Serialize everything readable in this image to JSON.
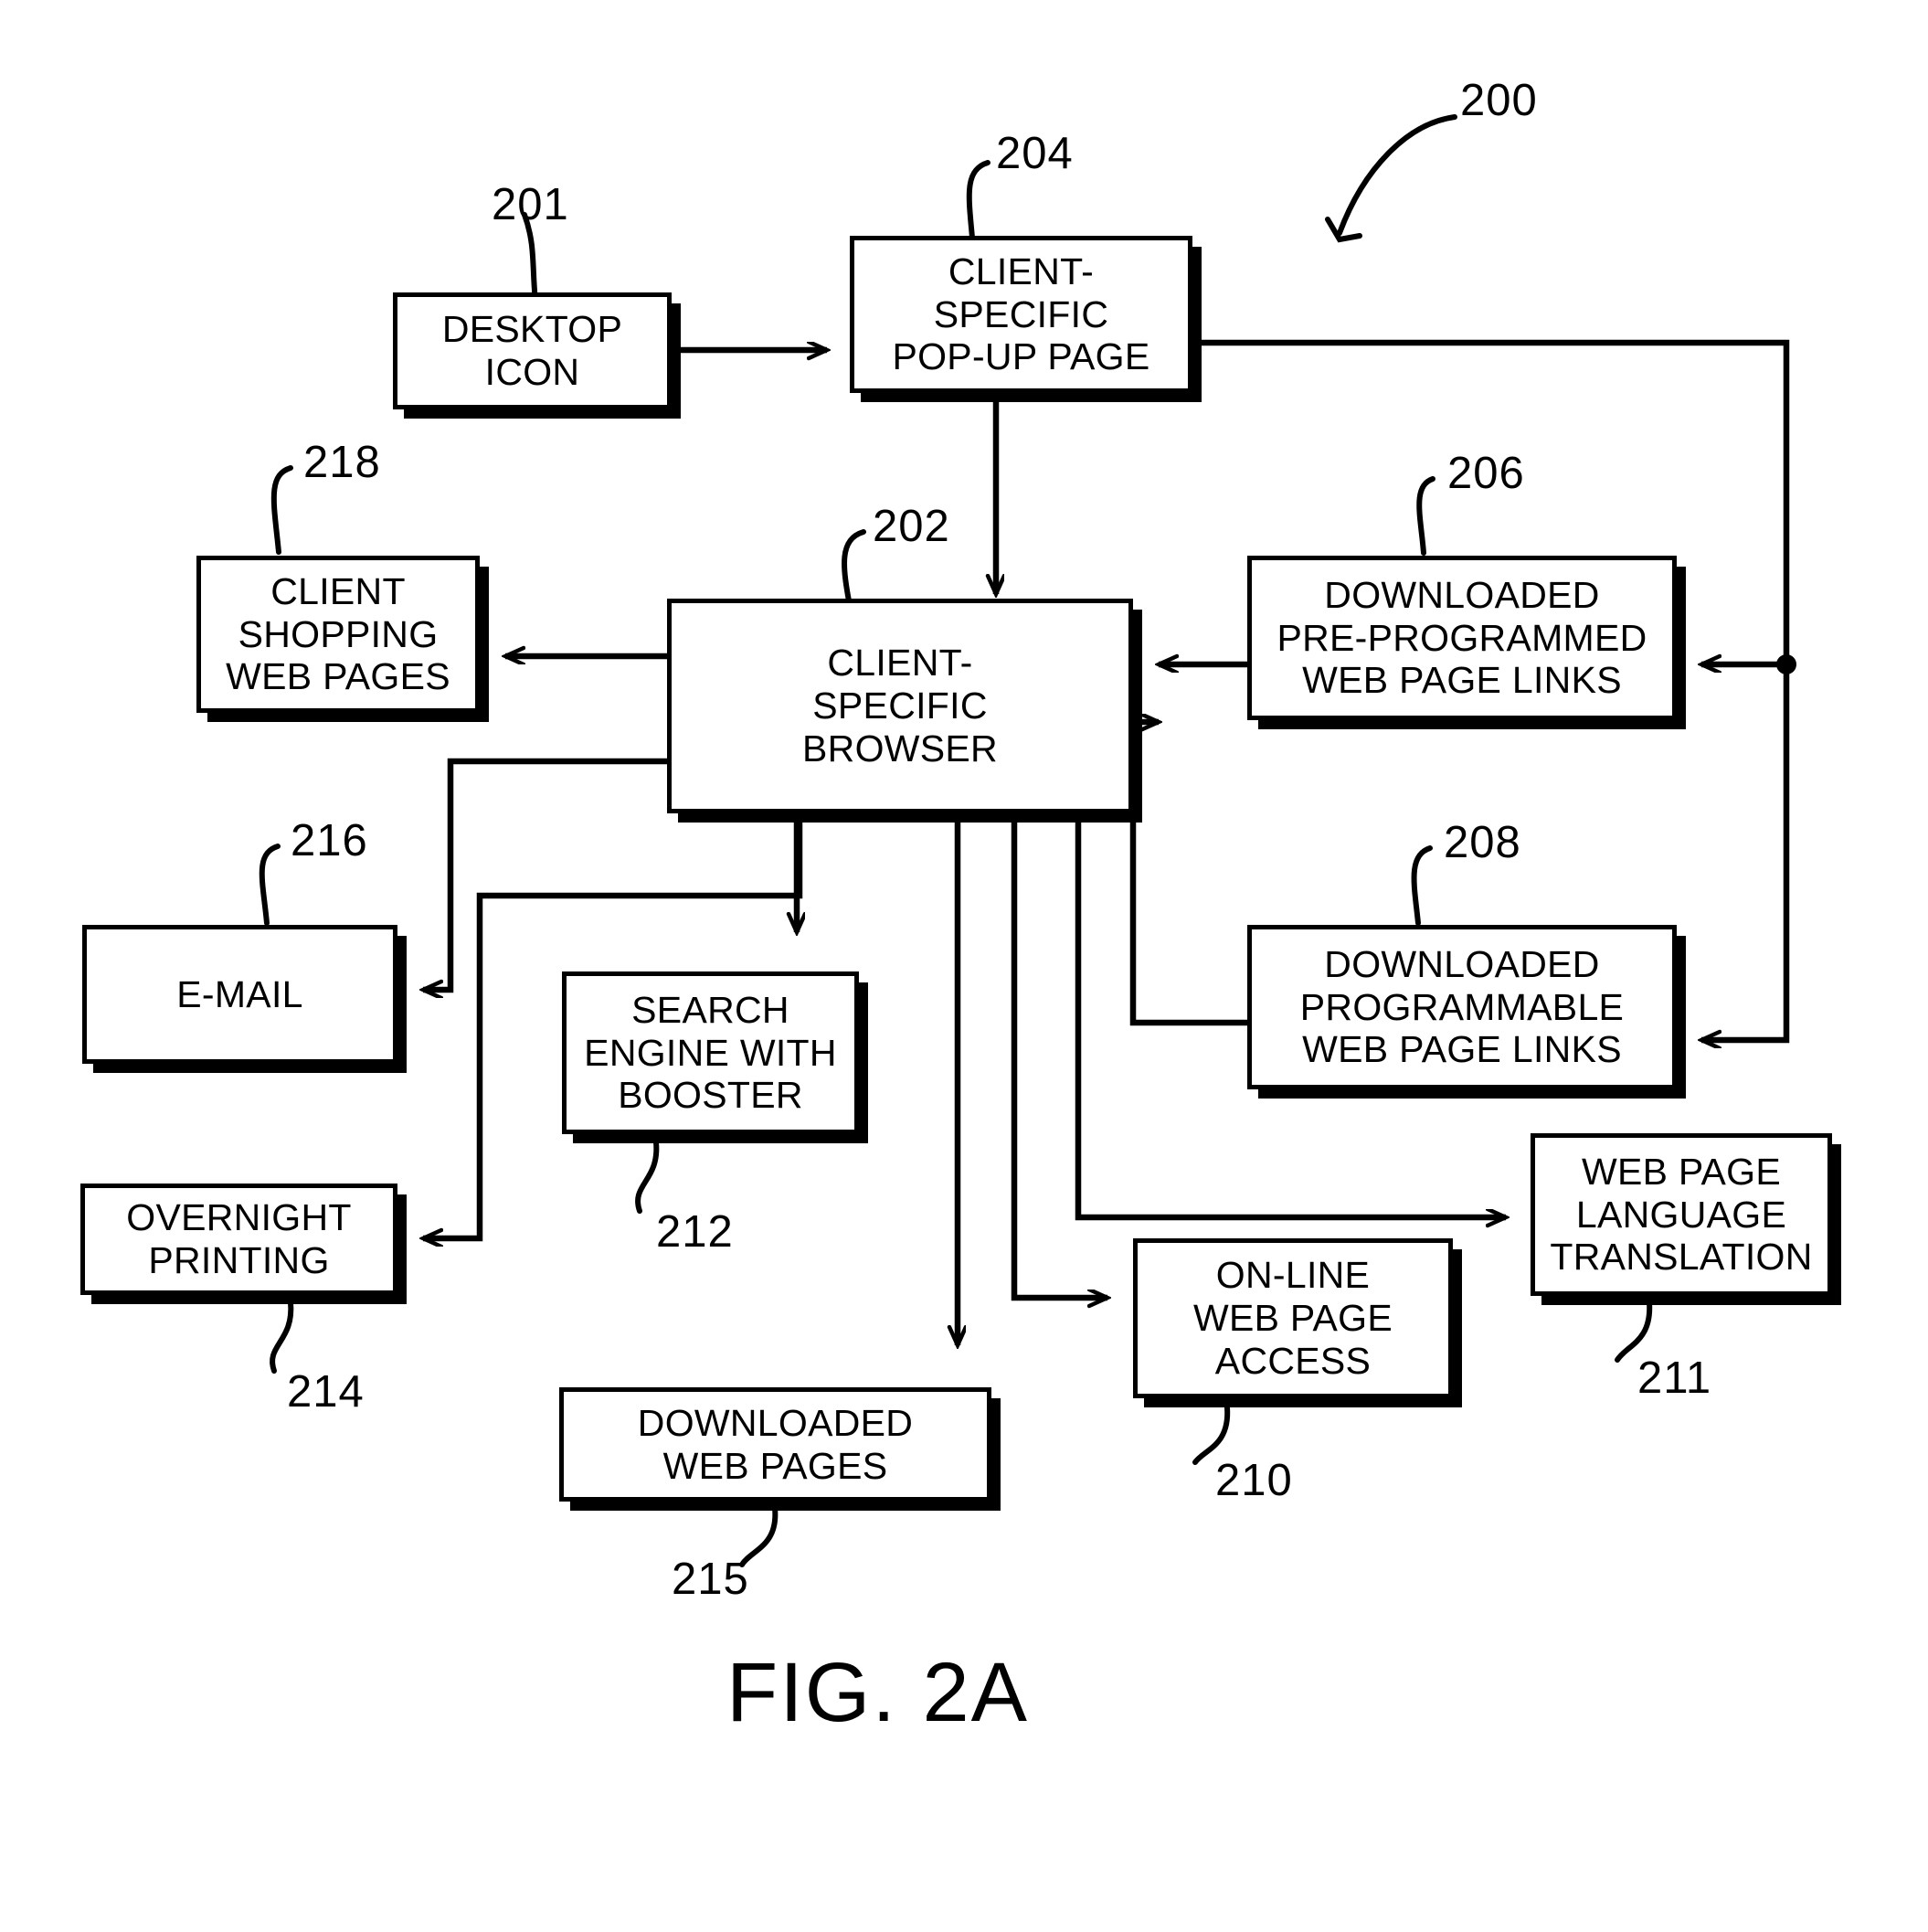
{
  "figure": {
    "label": "FIG. 2A",
    "system_ref": "200"
  },
  "nodes": [
    {
      "id": "201",
      "ref": "201",
      "lines": [
        "DESKTOP",
        "ICON"
      ]
    },
    {
      "id": "204",
      "ref": "204",
      "lines": [
        "CLIENT-",
        "SPECIFIC",
        "POP-UP PAGE"
      ]
    },
    {
      "id": "202",
      "ref": "202",
      "lines": [
        "CLIENT-",
        "SPECIFIC",
        "BROWSER"
      ]
    },
    {
      "id": "218",
      "ref": "218",
      "lines": [
        "CLIENT",
        "SHOPPING",
        "WEB PAGES"
      ]
    },
    {
      "id": "206",
      "ref": "206",
      "lines": [
        "DOWNLOADED",
        "PRE-PROGRAMMED",
        "WEB PAGE LINKS"
      ]
    },
    {
      "id": "208",
      "ref": "208",
      "lines": [
        "DOWNLOADED",
        "PROGRAMMABLE",
        "WEB PAGE LINKS"
      ]
    },
    {
      "id": "216",
      "ref": "216",
      "lines": [
        "E-MAIL"
      ]
    },
    {
      "id": "214",
      "ref": "214",
      "lines": [
        "OVERNIGHT",
        "PRINTING"
      ]
    },
    {
      "id": "212",
      "ref": "212",
      "lines": [
        "SEARCH",
        "ENGINE WITH",
        "BOOSTER"
      ]
    },
    {
      "id": "215",
      "ref": "215",
      "lines": [
        "DOWNLOADED",
        "WEB PAGES"
      ]
    },
    {
      "id": "210",
      "ref": "210",
      "lines": [
        "ON-LINE",
        "WEB PAGE",
        "ACCESS"
      ]
    },
    {
      "id": "211",
      "ref": "211",
      "lines": [
        "WEB PAGE",
        "LANGUAGE",
        "TRANSLATION"
      ]
    }
  ],
  "colors": {
    "ink": "#000000",
    "paper": "#ffffff"
  }
}
